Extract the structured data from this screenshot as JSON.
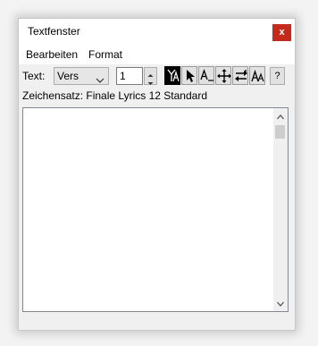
{
  "window": {
    "title": "Textfenster",
    "close_label": "x"
  },
  "menu": {
    "items": [
      {
        "label": "Bearbeiten"
      },
      {
        "label": "Format"
      }
    ]
  },
  "toolbar": {
    "text_label": "Text:",
    "type_select_value": "Vers",
    "number_value": "1",
    "tools": [
      {
        "icon": "text-baseline-icon",
        "active": true
      },
      {
        "icon": "pointer-arrow-icon",
        "active": false
      },
      {
        "icon": "text-underline-icon",
        "active": false
      },
      {
        "icon": "move-cross-icon",
        "active": false
      },
      {
        "icon": "swap-arrows-icon",
        "active": false
      },
      {
        "icon": "text-size-icon",
        "active": false
      }
    ],
    "help_label": "?"
  },
  "font_info": {
    "text": "Zeichensatz: Finale Lyrics 12 Standard"
  },
  "colors": {
    "close_button": "#c42b1c",
    "active_tool": "#000000",
    "window_bg": "#f0f0f0"
  }
}
